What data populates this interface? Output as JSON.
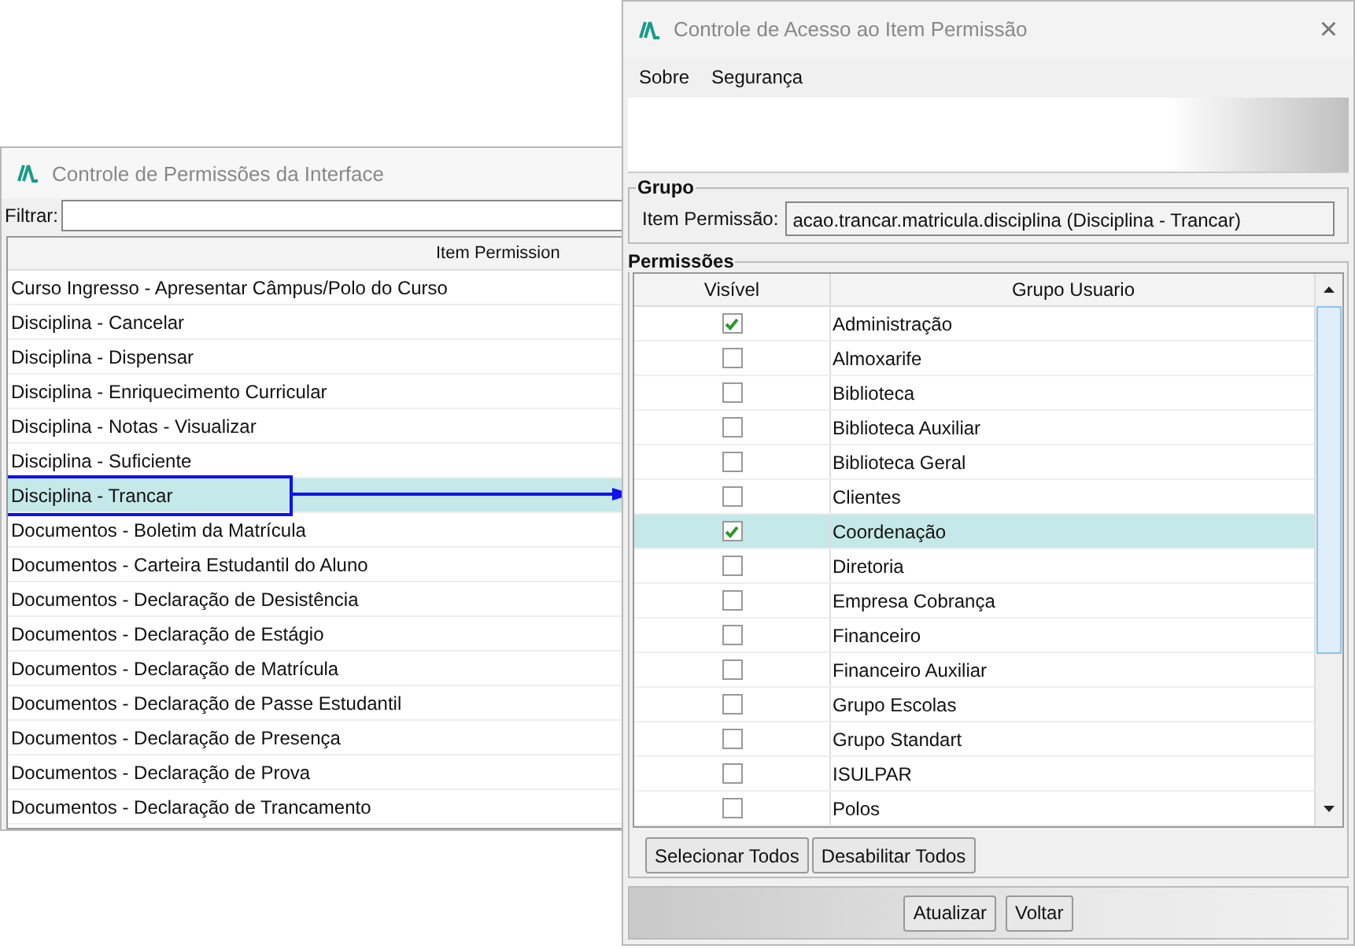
{
  "left_window": {
    "title": "Controle de Permissões da Interface",
    "filter": {
      "label": "Filtrar:"
    },
    "table": {
      "columns": [
        "Item Permission"
      ],
      "rows": [
        {
          "text": "Curso Ingresso - Apresentar Câmpus/Polo do Curso",
          "selected": false
        },
        {
          "text": "Disciplina - Cancelar",
          "selected": false
        },
        {
          "text": "Disciplina - Dispensar",
          "selected": false
        },
        {
          "text": "Disciplina - Enriquecimento Curricular",
          "selected": false
        },
        {
          "text": "Disciplina - Notas - Visualizar",
          "selected": false
        },
        {
          "text": "Disciplina - Suficiente",
          "selected": false
        },
        {
          "text": "Disciplina - Trancar",
          "selected": true
        },
        {
          "text": "Documentos - Boletim da Matrícula",
          "selected": false
        },
        {
          "text": "Documentos - Carteira Estudantil do Aluno",
          "selected": false
        },
        {
          "text": "Documentos - Declaração de Desistência",
          "selected": false
        },
        {
          "text": "Documentos - Declaração de Estágio",
          "selected": false
        },
        {
          "text": "Documentos - Declaração de Matrícula",
          "selected": false
        },
        {
          "text": "Documentos - Declaração de Passe Estudantil",
          "selected": false
        },
        {
          "text": "Documentos - Declaração de Presença",
          "selected": false
        },
        {
          "text": "Documentos - Declaração de Prova",
          "selected": false
        },
        {
          "text": "Documentos - Declaração de Trancamento",
          "selected": false
        }
      ]
    }
  },
  "right_window": {
    "title": "Controle de Acesso ao Item Permissão",
    "close": "×",
    "menu": [
      "Sobre",
      "Segurança"
    ],
    "grupo": {
      "legend": "Grupo",
      "label": "Item Permissão:",
      "value": "acao.trancar.matricula.disciplina (Disciplina - Trancar)"
    },
    "permissoes": {
      "legend": "Permissões",
      "columns": [
        "Visível",
        "Grupo Usuario"
      ],
      "rows": [
        {
          "name": "Administração",
          "checked": true,
          "selected": false
        },
        {
          "name": "Almoxarife",
          "checked": false,
          "selected": false
        },
        {
          "name": "Biblioteca",
          "checked": false,
          "selected": false
        },
        {
          "name": "Biblioteca Auxiliar",
          "checked": false,
          "selected": false
        },
        {
          "name": "Biblioteca Geral",
          "checked": false,
          "selected": false
        },
        {
          "name": "Clientes",
          "checked": false,
          "selected": false
        },
        {
          "name": "Coordenação",
          "checked": true,
          "selected": true
        },
        {
          "name": "Diretoria",
          "checked": false,
          "selected": false
        },
        {
          "name": "Empresa Cobrança",
          "checked": false,
          "selected": false
        },
        {
          "name": "Financeiro",
          "checked": false,
          "selected": false
        },
        {
          "name": "Financeiro Auxiliar",
          "checked": false,
          "selected": false
        },
        {
          "name": "Grupo Escolas",
          "checked": false,
          "selected": false
        },
        {
          "name": "Grupo Standart",
          "checked": false,
          "selected": false
        },
        {
          "name": "ISULPAR",
          "checked": false,
          "selected": false
        },
        {
          "name": "Polos",
          "checked": false,
          "selected": false
        }
      ],
      "buttons": [
        "Selecionar Todos",
        "Desabilitar Todos"
      ]
    },
    "footer_buttons": [
      "Atualizar",
      "Voltar"
    ]
  }
}
